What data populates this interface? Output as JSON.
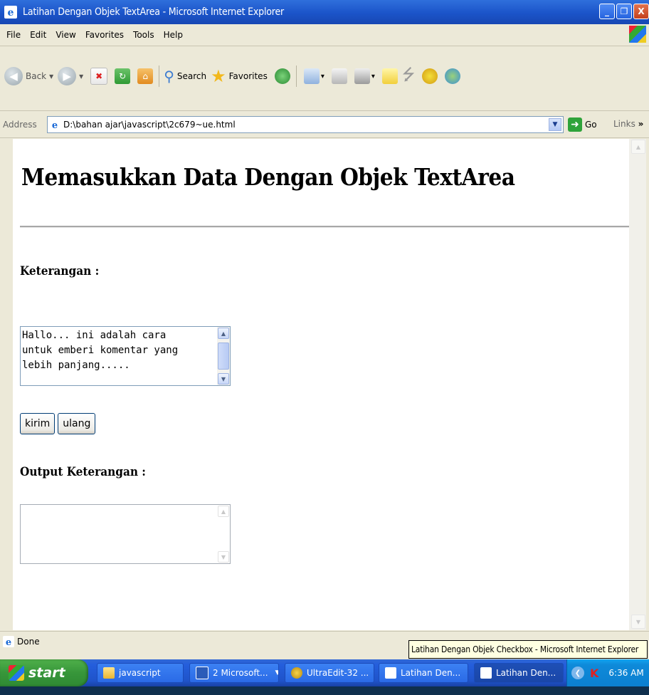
{
  "window": {
    "title": "Latihan Dengan Objek TextArea - Microsoft Internet Explorer",
    "controls": {
      "minimize": "_",
      "maximize": "❐",
      "close": "X"
    }
  },
  "menubar": {
    "items": [
      "File",
      "Edit",
      "View",
      "Favorites",
      "Tools",
      "Help"
    ]
  },
  "toolbar": {
    "back_label": "Back",
    "search_label": "Search",
    "favorites_label": "Favorites"
  },
  "address": {
    "label": "Address",
    "value": "D:\\bahan ajar\\javascript\\2c679~ue.html",
    "go_label": "Go",
    "links_label": "Links",
    "links_more": "»"
  },
  "page": {
    "title": "Memasukkan Data Dengan Objek TextArea",
    "keterangan_heading": "Keterangan :",
    "keterangan_text": "Hallo... ini adalah cara\nuntuk emberi komentar yang\nlebih panjang.....",
    "kirim_label": "kirim",
    "ulang_label": "ulang",
    "output_heading": "Output Keterangan :",
    "output_text": ""
  },
  "status": {
    "text": "Done",
    "tooltip": "Latihan Dengan Objek Checkbox - Microsoft Internet Explorer"
  },
  "taskbar": {
    "start_label": "start",
    "tasks": [
      {
        "label": "javascript"
      },
      {
        "label": "2 Microsoft..."
      },
      {
        "label": "UltraEdit-32 ..."
      },
      {
        "label": "Latihan Den..."
      },
      {
        "label": "Latihan Den..."
      }
    ],
    "clock": "6:36 AM"
  },
  "colors": {
    "titlebar": "#1b54c9",
    "taskbar": "#245edc",
    "start": "#37963a",
    "tray": "#0e8ad9"
  }
}
